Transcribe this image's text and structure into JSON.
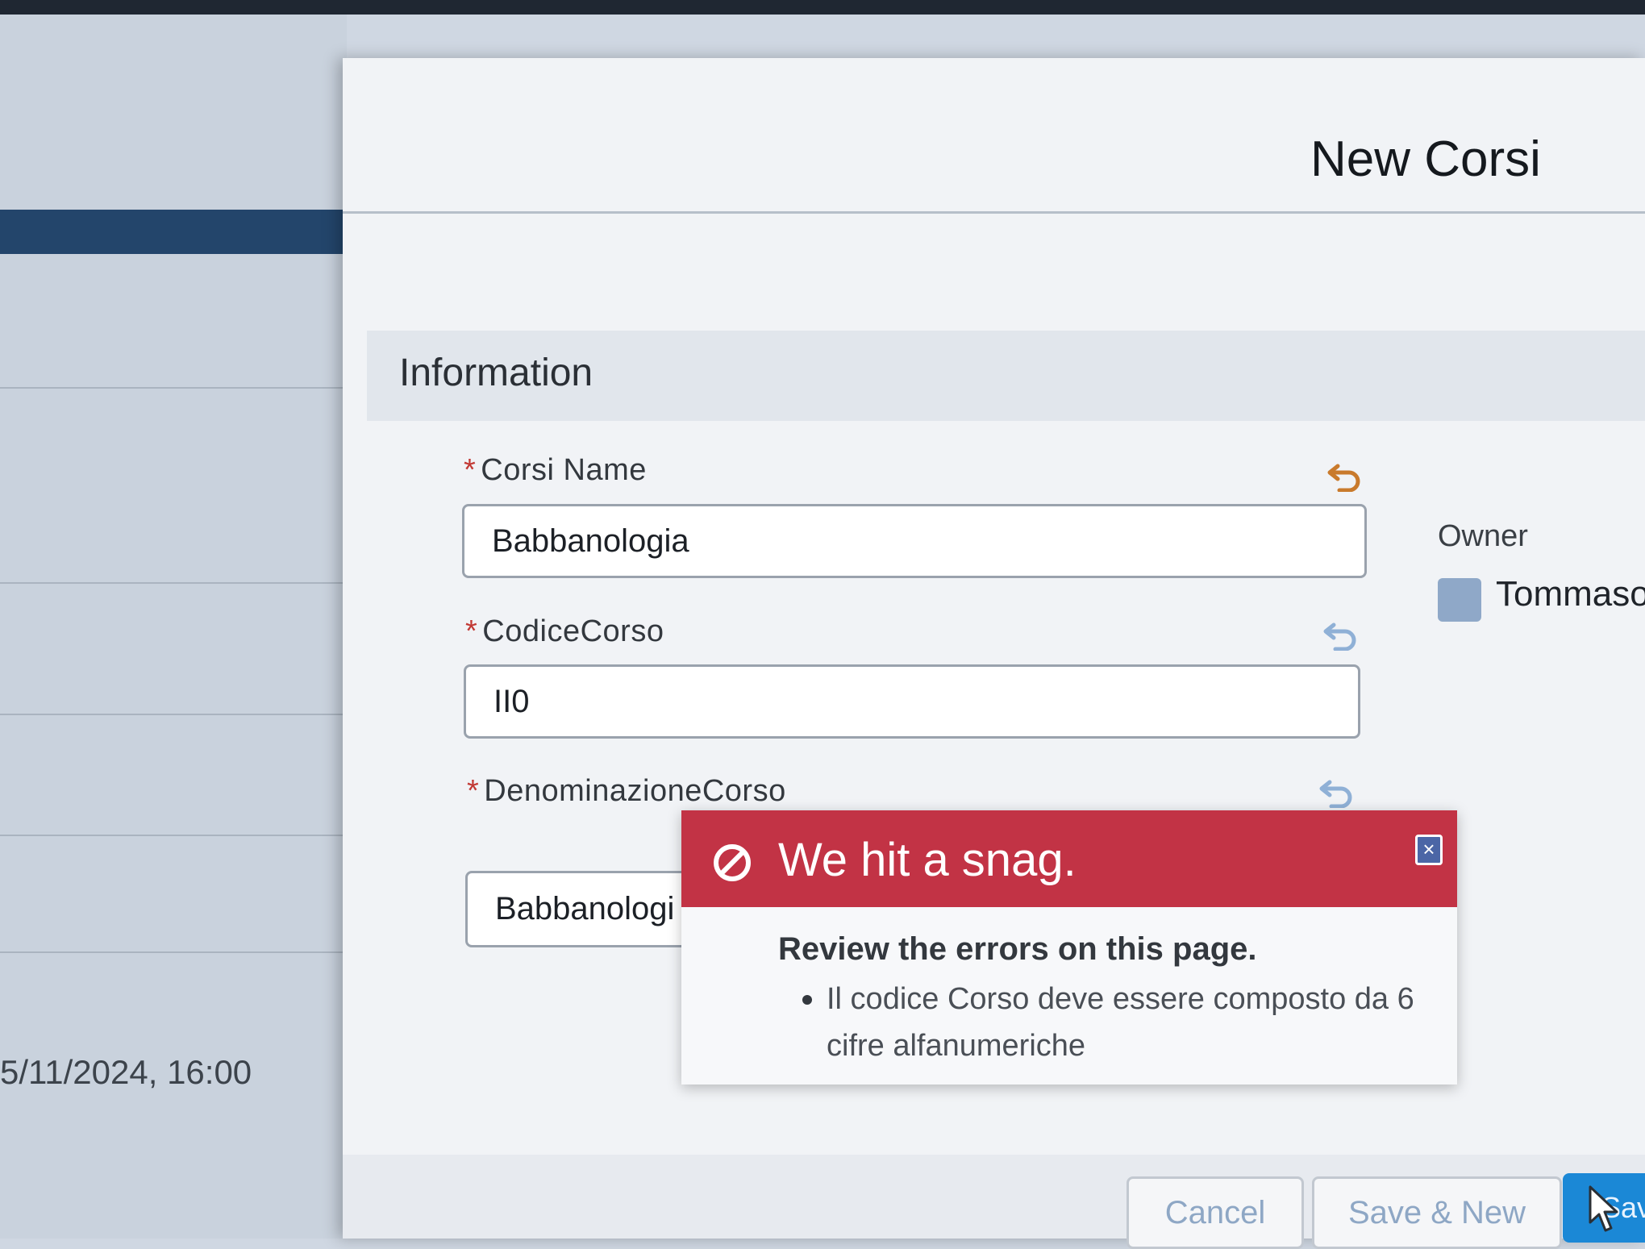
{
  "background": {
    "timestamp": "5/11/2024, 16:00"
  },
  "modal": {
    "title": "New Corsi",
    "section_title": "Information",
    "fields": {
      "corsi_name": {
        "label": "Corsi Name",
        "required": "*",
        "value": "Babbanologia"
      },
      "codice_corso": {
        "label": "CodiceCorso",
        "required": "*",
        "value": "II0"
      },
      "denominazione_corso": {
        "label": "DenominazioneCorso",
        "required": "*",
        "value": "Babbanologi"
      }
    },
    "owner": {
      "label": "Owner",
      "name": "Tommaso",
      "icon": "user-avatar-icon"
    }
  },
  "error": {
    "title": "We hit a snag.",
    "review": "Review the errors on this page.",
    "items": [
      "Il codice Corso deve essere composto da 6 cifre alfanumeriche"
    ],
    "icon": "ban-icon",
    "close_icon": "close-icon",
    "header_color": "#c23345"
  },
  "footer": {
    "cancel_label": "Cancel",
    "save_new_label": "Save & New",
    "save_label": "Sav",
    "save_color": "#1b88d6",
    "error_icon": "ban-icon"
  }
}
